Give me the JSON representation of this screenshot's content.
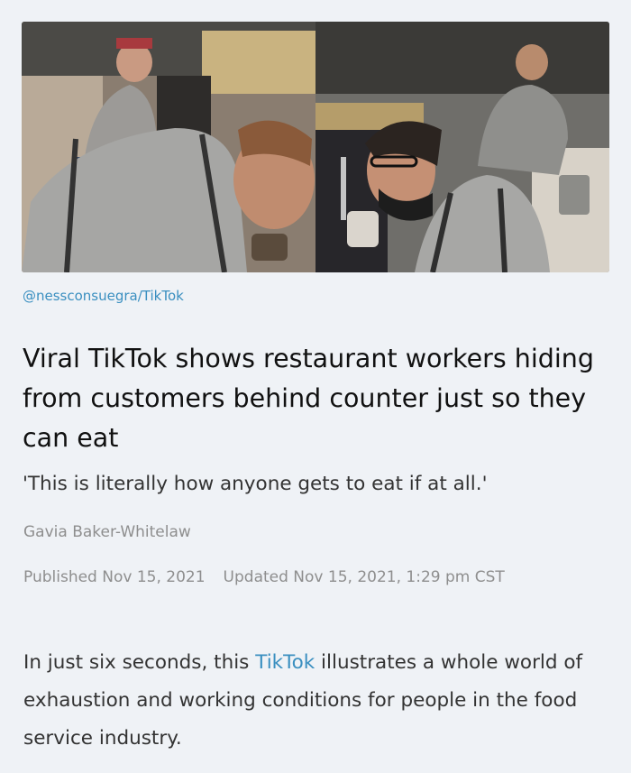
{
  "article": {
    "photo_credit": "@nessconsuegra/TikTok",
    "headline": "Viral TikTok shows restaurant workers hiding from customers behind counter just so they can eat",
    "dek": "'This is literally how anyone gets to eat if at all.'",
    "author": "Gavia Baker-Whitelaw",
    "published": "Published Nov 15, 2021",
    "updated": "Updated Nov 15, 2021, 1:29 pm CST",
    "body_before": "In just six seconds, this ",
    "body_link": "TikTok",
    "body_after": " illustrates a whole world of exhaustion and working conditions for people in the food service industry."
  },
  "colors": {
    "background": "#eff2f6",
    "link": "#3a8fc0",
    "meta": "#8e8e8e",
    "headline": "#111111"
  }
}
